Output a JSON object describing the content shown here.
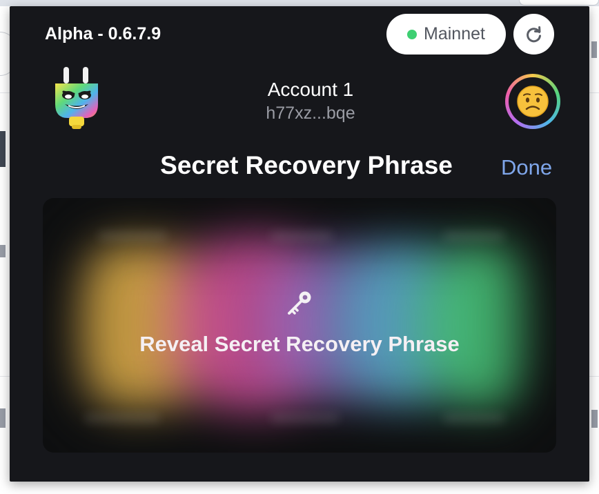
{
  "header": {
    "version": "Alpha - 0.6.7.9",
    "network": {
      "label": "Mainnet",
      "status_color": "#3ecf72"
    },
    "refresh_icon": "refresh-icon"
  },
  "account": {
    "name": "Account 1",
    "address": "h77xz...bqe",
    "avatar_emoji": "😟"
  },
  "section": {
    "title": "Secret Recovery Phrase",
    "done_label": "Done"
  },
  "phrase_card": {
    "icon": "key-icon",
    "reveal_label": "Reveal Secret Recovery Phrase"
  },
  "colors": {
    "popup_bg": "#16171b",
    "accent_link": "#7fa6ea",
    "network_dot": "#3ecf72"
  }
}
